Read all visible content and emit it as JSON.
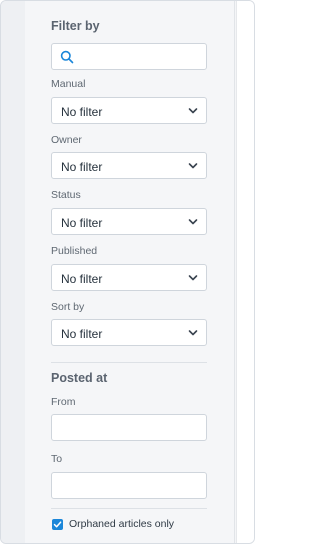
{
  "filter": {
    "title": "Filter by",
    "search_placeholder": "",
    "selects": [
      {
        "label": "Manual",
        "value": "No filter"
      },
      {
        "label": "Owner",
        "value": "No filter"
      },
      {
        "label": "Status",
        "value": "No filter"
      },
      {
        "label": "Published",
        "value": "No filter"
      },
      {
        "label": "Sort by",
        "value": "No filter"
      }
    ]
  },
  "posted_at": {
    "title": "Posted at",
    "from_label": "From",
    "from_value": "",
    "to_label": "To",
    "to_value": ""
  },
  "orphaned": {
    "label": "Orphaned articles only",
    "checked": true
  },
  "colors": {
    "accent": "#1a86d9",
    "panel_bg": "#f5f6f8"
  }
}
